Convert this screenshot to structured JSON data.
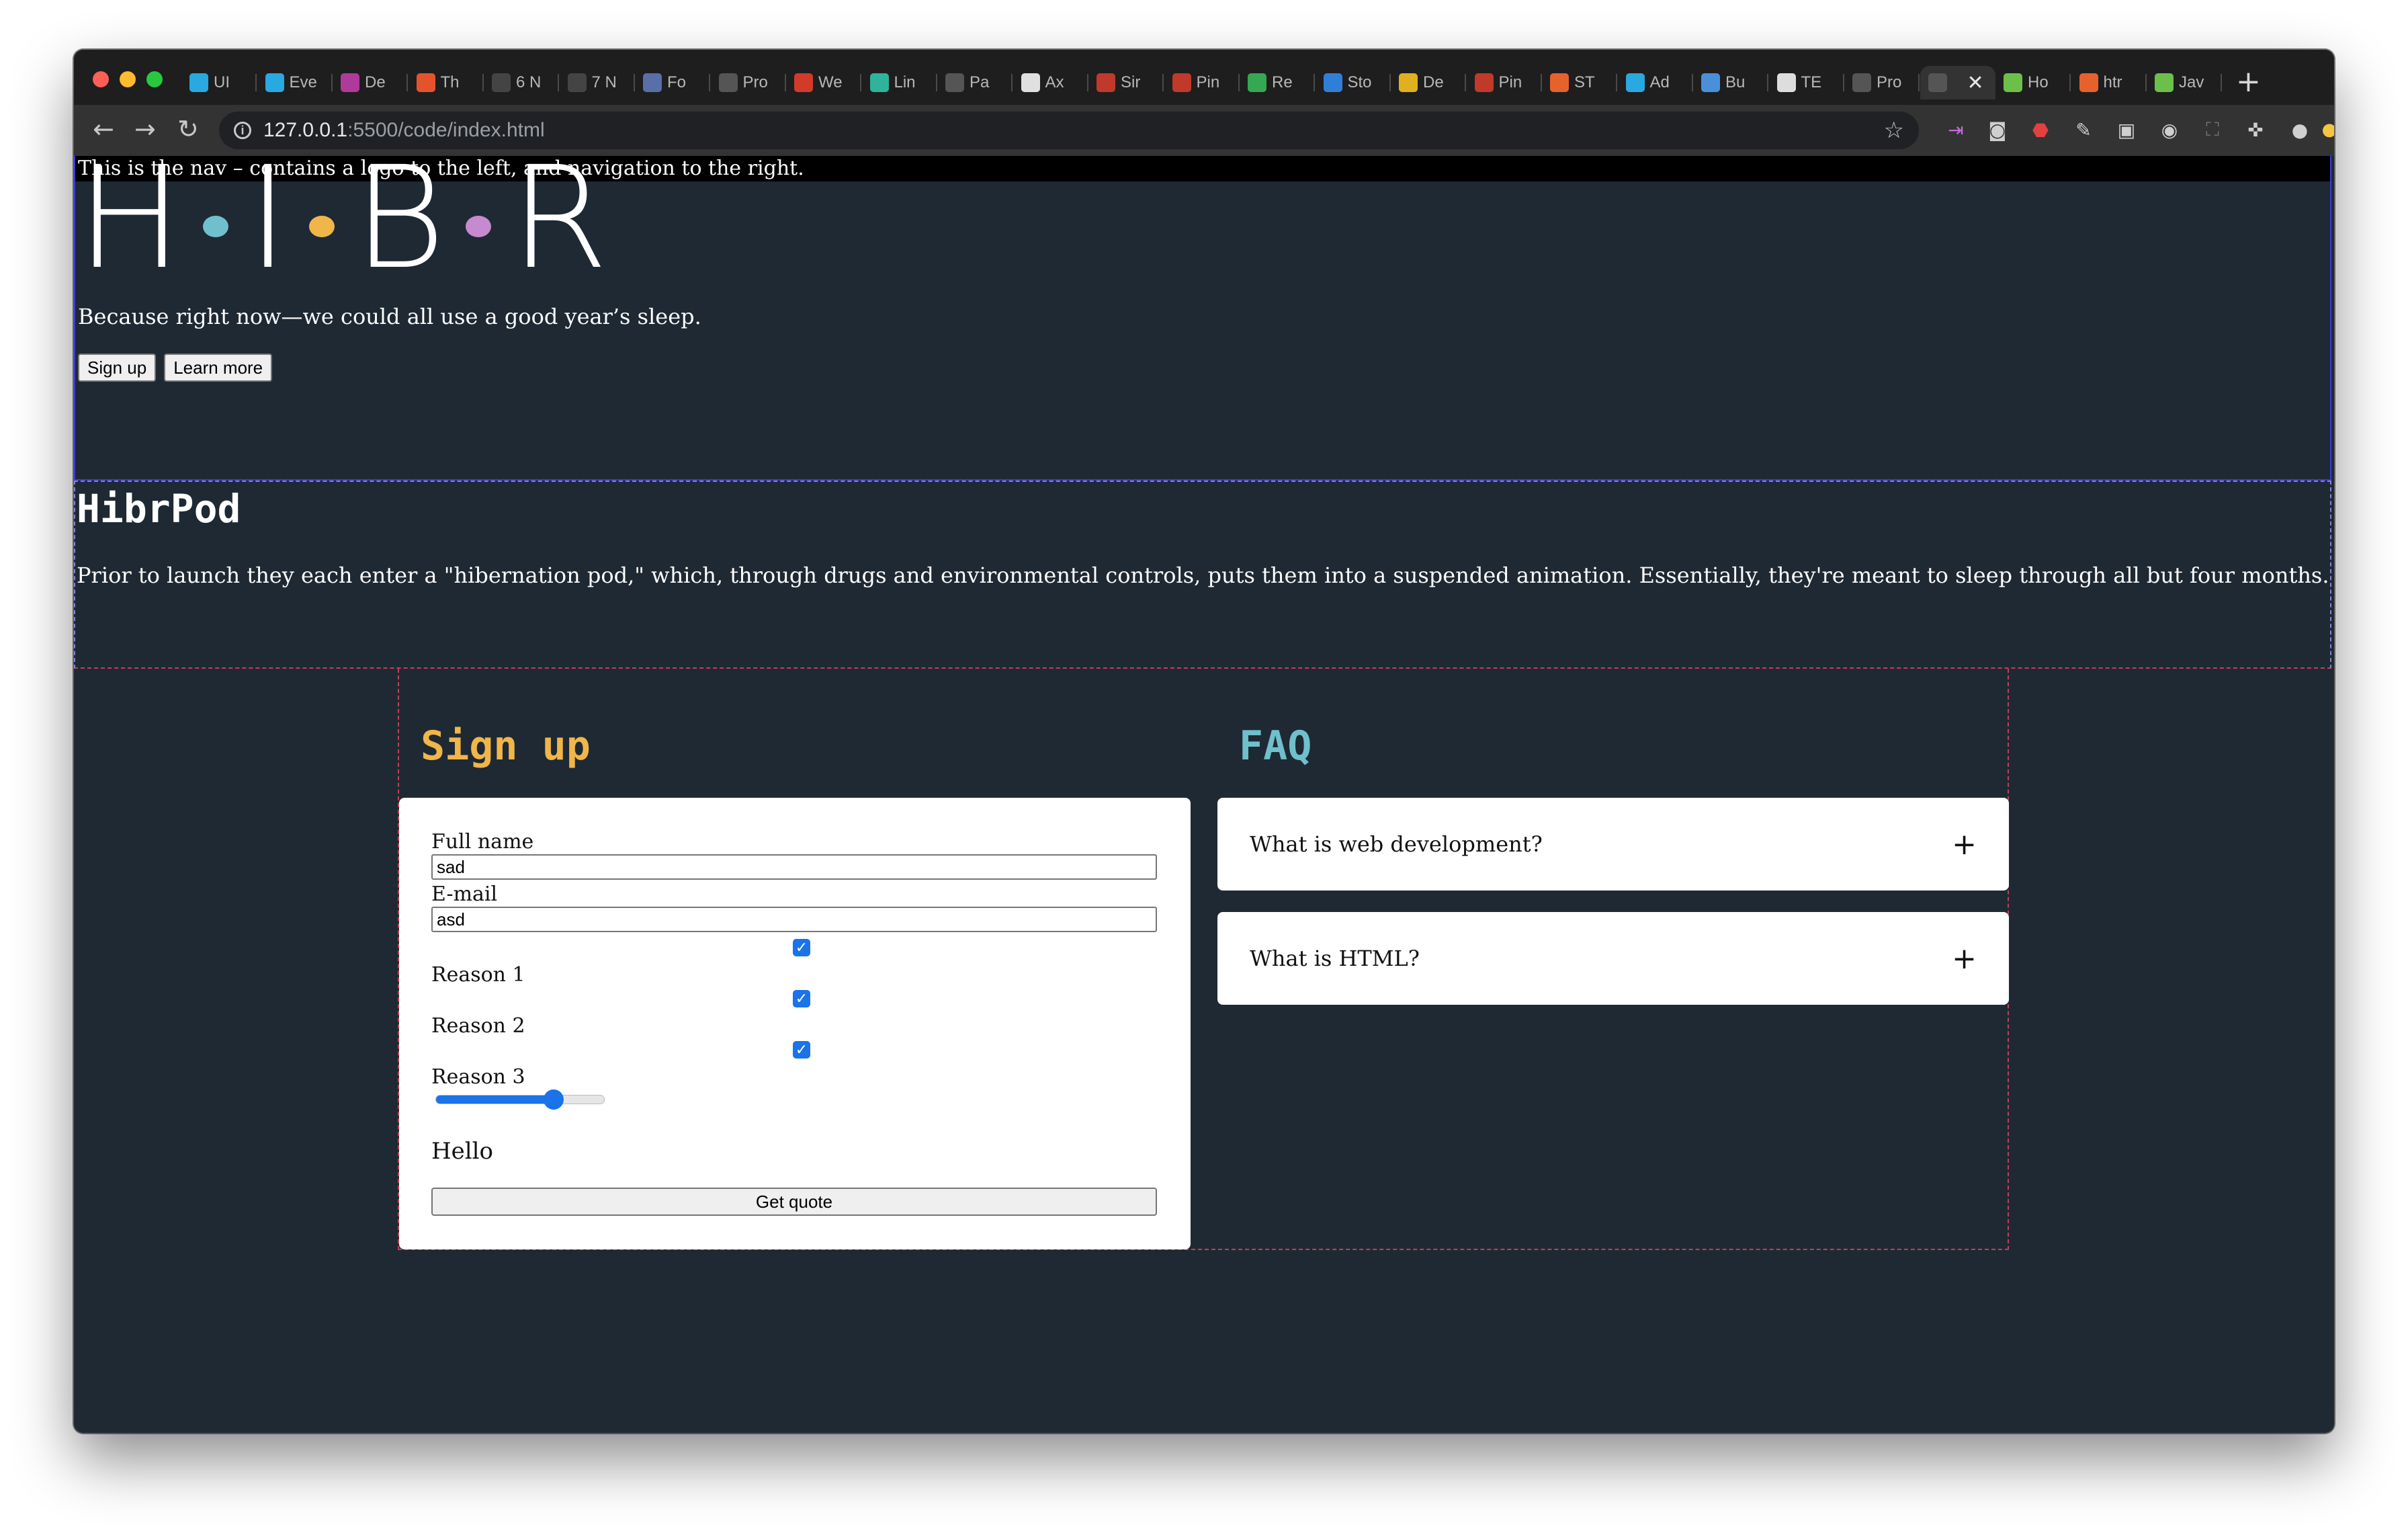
{
  "browser": {
    "tabs": [
      {
        "label": "UI",
        "color": "#2aa8e0"
      },
      {
        "label": "Eve",
        "color": "#2aa8e0"
      },
      {
        "label": "De",
        "color": "#b03a9a"
      },
      {
        "label": "Th",
        "color": "#e5532d"
      },
      {
        "label": "6 N",
        "color": "#444444"
      },
      {
        "label": "7 N",
        "color": "#444444"
      },
      {
        "label": "Fo",
        "color": "#5a6ea8"
      },
      {
        "label": "Pro",
        "color": "#555555"
      },
      {
        "label": "We",
        "color": "#d23a2a"
      },
      {
        "label": "Lin",
        "color": "#2fb39a"
      },
      {
        "label": "Pa",
        "color": "#555555"
      },
      {
        "label": "Ax",
        "color": "#e0e0e0"
      },
      {
        "label": "Sir",
        "color": "#c0392b"
      },
      {
        "label": "Pin",
        "color": "#c0392b"
      },
      {
        "label": "Re",
        "color": "#34a853"
      },
      {
        "label": "Sto",
        "color": "#2f7fd8"
      },
      {
        "label": "De",
        "color": "#e0b020"
      },
      {
        "label": "Pin",
        "color": "#c0392b"
      },
      {
        "label": "ST",
        "color": "#e5622d"
      },
      {
        "label": "Ad",
        "color": "#2aa8e0"
      },
      {
        "label": "Bu",
        "color": "#4a90d9"
      },
      {
        "label": "TE",
        "color": "#dddddd"
      },
      {
        "label": "Pro",
        "color": "#555555"
      },
      {
        "label": "",
        "color": "#555555",
        "active": true
      },
      {
        "label": "Ho",
        "color": "#6cc04a"
      },
      {
        "label": "htr",
        "color": "#e5622d"
      },
      {
        "label": "Jav",
        "color": "#6cc04a"
      }
    ],
    "url_host": "127.0.0.1",
    "url_path": ":5500/code/index.html"
  },
  "nav": {
    "text": "This is the nav – contains a logo to the left, and navigation to the right."
  },
  "hero": {
    "logo_letters": [
      "H",
      "I",
      "B",
      "R"
    ],
    "logo_dot_colors": [
      "#6fc0cc",
      "#f0b64a",
      "#c58ad0"
    ],
    "tagline": "Because right now—we could all use a good year’s sleep.",
    "signup_label": "Sign up",
    "learn_more_label": "Learn more"
  },
  "about": {
    "title": "HibrPod",
    "text": "Prior to launch they each enter a \"hibernation pod,\" which, through drugs and environmental controls, puts them into a suspended animation. Essentially, they're meant to sleep through all but four months."
  },
  "signup": {
    "title": "Sign up",
    "full_name_label": "Full name",
    "full_name_value": "sad",
    "email_label": "E-mail",
    "email_value": "asd",
    "reasons": [
      {
        "label": "Reason 1",
        "checked": true
      },
      {
        "label": "Reason 2",
        "checked": true
      },
      {
        "label": "Reason 3",
        "checked": true
      }
    ],
    "slider_value_fraction": 0.7,
    "output_text": "Hello",
    "submit_label": "Get quote"
  },
  "faq": {
    "title": "FAQ",
    "items": [
      {
        "question": "What is web development?",
        "toggle": "+"
      },
      {
        "question": "What is HTML?",
        "toggle": "+"
      }
    ]
  }
}
